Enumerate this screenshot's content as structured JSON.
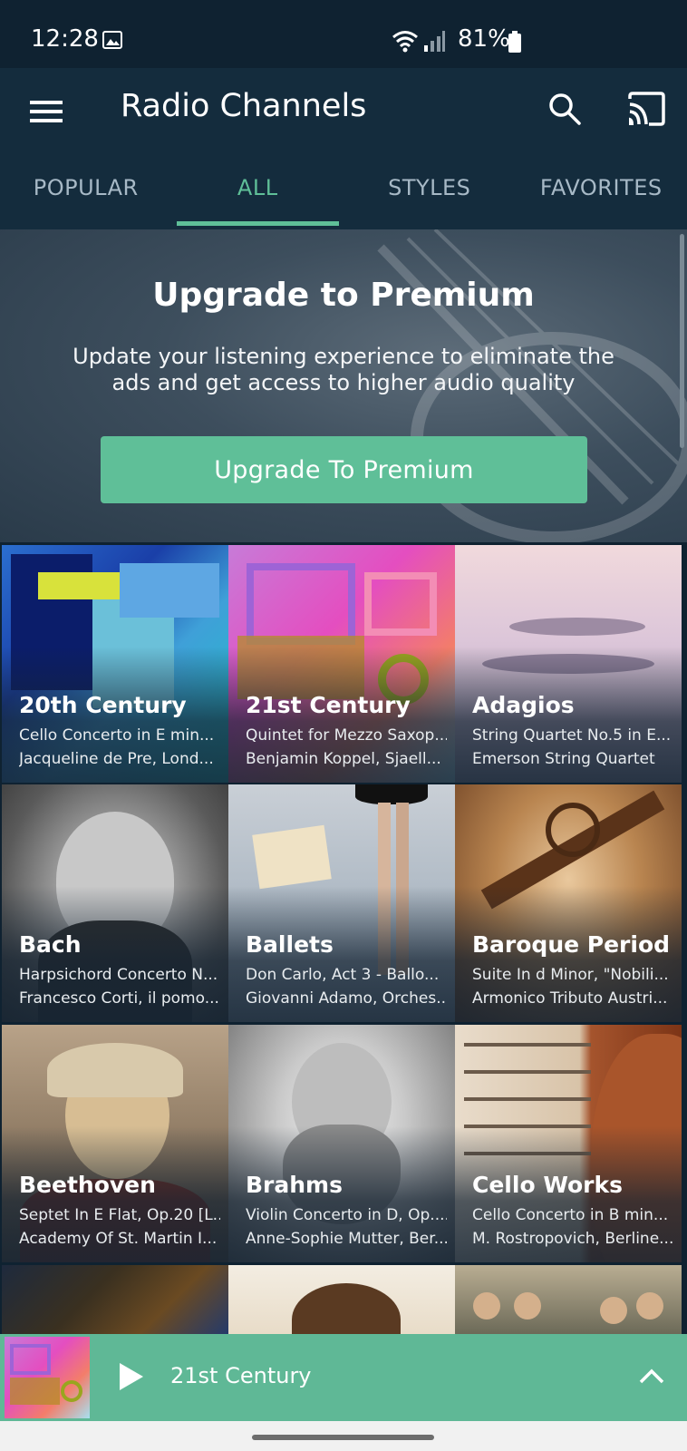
{
  "status_bar": {
    "time": "12:28",
    "battery": "81%"
  },
  "app_bar": {
    "title": "Radio Channels"
  },
  "tabs": [
    {
      "label": "POPULAR",
      "active": false
    },
    {
      "label": "ALL",
      "active": true
    },
    {
      "label": "STYLES",
      "active": false
    },
    {
      "label": "FAVORITES",
      "active": false
    }
  ],
  "premium": {
    "title": "Upgrade to Premium",
    "description": "Update your listening experience to eliminate the ads and get access to higher audio quality",
    "button_label": "Upgrade To Premium"
  },
  "channels": [
    {
      "name": "20th Century",
      "line1": "Cello Concerto in E min...",
      "line2": "Jacqueline de Pre, Lond..."
    },
    {
      "name": "21st Century",
      "line1": "Quintet for Mezzo Saxop...",
      "line2": "Benjamin Koppel, Sjaell..."
    },
    {
      "name": "Adagios",
      "line1": "String Quartet No.5 in E...",
      "line2": "Emerson String Quartet"
    },
    {
      "name": "Bach",
      "line1": "Harpsichord Concerto N...",
      "line2": "Francesco Corti, il pomo..."
    },
    {
      "name": "Ballets",
      "line1": "Don Carlo, Act 3 - Ballo...",
      "line2": "Giovanni Adamo, Orches..."
    },
    {
      "name": "Baroque Period",
      "line1": "Suite In d Minor, \"Nobili...",
      "line2": "Armonico Tributo Austri..."
    },
    {
      "name": "Beethoven",
      "line1": "Septet In E Flat, Op.20 [L...",
      "line2": "Academy Of St. Martin I..."
    },
    {
      "name": "Brahms",
      "line1": "Violin Concerto in D, Op....",
      "line2": "Anne-Sophie Mutter, Ber..."
    },
    {
      "name": "Cello Works",
      "line1": "Cello Concerto in B min...",
      "line2": "M. Rostropovich, Berline..."
    }
  ],
  "now_playing": {
    "title": "21st Century"
  },
  "colors": {
    "accent": "#5fbf98",
    "app_bar": "#142c3d",
    "player": "#5fb896"
  }
}
